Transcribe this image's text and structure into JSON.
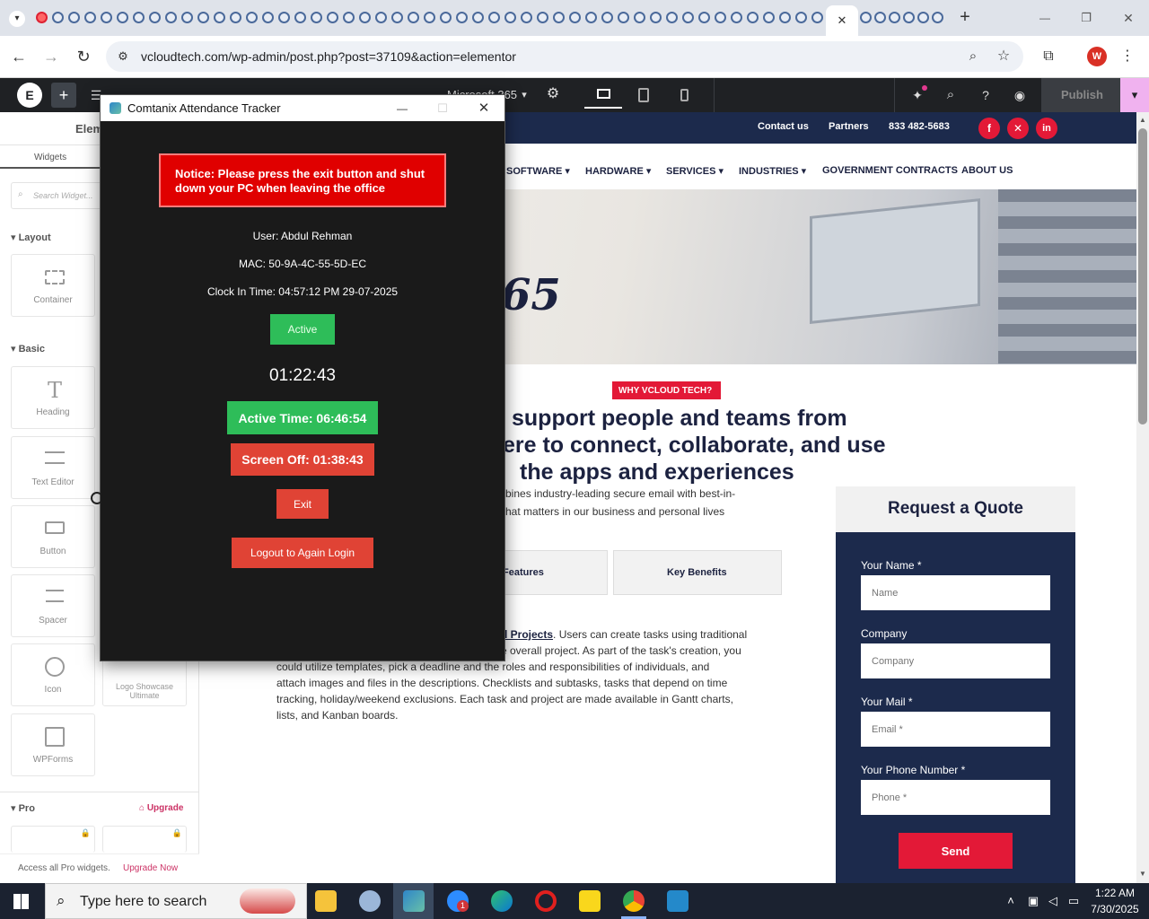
{
  "browser": {
    "url": "vcloudtech.com/wp-admin/post.php?post=37109&action=elementor",
    "new_tab_symbol": "+",
    "minimize_symbol": "—",
    "restore_symbol": "❐",
    "close_symbol": "✕",
    "tab_close_symbol": "✕",
    "profile_initial": "W"
  },
  "elementor": {
    "page_selector": "Microsoft 365",
    "publish_label": "Publish",
    "panel_title": "Elem",
    "tab_widgets": "Widgets",
    "search_placeholder": "Search Widget...",
    "sections": {
      "layout": "Layout",
      "basic": "Basic",
      "pro": "Pro",
      "upgrade": "Upgrade"
    },
    "widgets": {
      "container": "Container",
      "heading": "Heading",
      "text_editor": "Text Editor",
      "button": "Button",
      "spacer": "Spacer",
      "icon": "Icon",
      "wpforms": "WPForms",
      "logo_showcase": "Logo Showcase Ultimate"
    },
    "pro_footer": "Access all Pro widgets.",
    "pro_footer_link": "Upgrade Now"
  },
  "site": {
    "topbar": {
      "contact": "Contact us",
      "partners": "Partners",
      "phone": "833 482-5683"
    },
    "nav": {
      "software": "SOFTWARE",
      "hardware": "HARDWARE",
      "services": "SERVICES",
      "industries": "INDUSTRIES",
      "gov": "GOVERNMENT CONTRACTS",
      "about": "ABOUT US"
    },
    "hero_fragment": "65",
    "badge": "WHY VCLOUD TECH?",
    "headline_1": "support people and teams from",
    "headline_2": "ere to connect, collaborate, and use",
    "headline_3": "the apps and experiences",
    "sub_1": "bines industry-leading secure email with best-in-",
    "sub_2": "hat matters in our business and personal lives",
    "tab_features": "Features",
    "tab_benefits": "Key Benefits",
    "body_link": "d Projects",
    "body_1": ". Users can create tasks using traditional",
    "body_2": "e overall project. As part of the task's creation, you",
    "body_3": "could utilize templates, pick a deadline and the roles and responsibilities of individuals, and",
    "body_4": "attach images and files in the descriptions. Checklists and subtasks, tasks that depend on time",
    "body_5": "tracking, holiday/weekend exclusions. Each task and project are made available in Gantt charts,",
    "body_6": "lists, and Kanban boards.",
    "quote": {
      "title": "Request a Quote",
      "name_label": "Your Name *",
      "name_ph": "Name",
      "company_label": "Company",
      "company_ph": "Company",
      "mail_label": "Your Mail *",
      "mail_ph": "Email *",
      "phone_label": "Your Phone Number *",
      "phone_ph": "Phone *",
      "send": "Send"
    }
  },
  "tracker": {
    "title": "Comtanix Attendance Tracker",
    "notice": "Notice: Please press the exit button and shut down your PC when leaving the office",
    "user": "User: Abdul Rehman",
    "mac": "MAC: 50-9A-4C-55-5D-EC",
    "clock_in": "Clock In Time: 04:57:12 PM 29-07-2025",
    "status": "Active",
    "timer": "01:22:43",
    "active_time": "Active Time: 06:46:54",
    "screen_off": "Screen Off: 01:38:43",
    "exit": "Exit",
    "logout": "Logout to Again Login",
    "minimize_symbol": "—",
    "maximize_symbol": "☐",
    "close_symbol": "✕"
  },
  "taskbar": {
    "search_placeholder": "Type here to search",
    "time": "1:22 AM",
    "date": "7/30/2025",
    "zoom_badge": "1"
  },
  "colors": {
    "tracker_bg": "#1a1a1a",
    "notice_red": "#e00000",
    "active_green": "#2ebd59",
    "danger_red": "#e04335",
    "site_navy": "#1c2a4c",
    "brand_red": "#e31937"
  }
}
